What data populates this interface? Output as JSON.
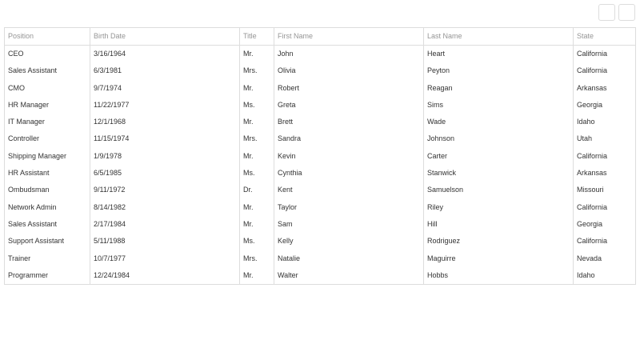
{
  "columns": [
    "Position",
    "Birth Date",
    "Title",
    "First Name",
    "Last Name",
    "State"
  ],
  "rows": [
    [
      "CEO",
      "3/16/1964",
      "Mr.",
      "John",
      "Heart",
      "California"
    ],
    [
      "Sales Assistant",
      "6/3/1981",
      "Mrs.",
      "Olivia",
      "Peyton",
      "California"
    ],
    [
      "CMO",
      "9/7/1974",
      "Mr.",
      "Robert",
      "Reagan",
      "Arkansas"
    ],
    [
      "HR Manager",
      "11/22/1977",
      "Ms.",
      "Greta",
      "Sims",
      "Georgia"
    ],
    [
      "IT Manager",
      "12/1/1968",
      "Mr.",
      "Brett",
      "Wade",
      "Idaho"
    ],
    [
      "Controller",
      "11/15/1974",
      "Mrs.",
      "Sandra",
      "Johnson",
      "Utah"
    ],
    [
      "Shipping Manager",
      "1/9/1978",
      "Mr.",
      "Kevin",
      "Carter",
      "California"
    ],
    [
      "HR Assistant",
      "6/5/1985",
      "Ms.",
      "Cynthia",
      "Stanwick",
      "Arkansas"
    ],
    [
      "Ombudsman",
      "9/11/1972",
      "Dr.",
      "Kent",
      "Samuelson",
      "Missouri"
    ],
    [
      "Network Admin",
      "8/14/1982",
      "Mr.",
      "Taylor",
      "Riley",
      "California"
    ],
    [
      "Sales Assistant",
      "2/17/1984",
      "Mr.",
      "Sam",
      "Hill",
      "Georgia"
    ],
    [
      "Support Assistant",
      "5/11/1988",
      "Ms.",
      "Kelly",
      "Rodriguez",
      "California"
    ],
    [
      "Trainer",
      "10/7/1977",
      "Mrs.",
      "Natalie",
      "Maguirre",
      "Nevada"
    ],
    [
      "Programmer",
      "12/24/1984",
      "Mr.",
      "Walter",
      "Hobbs",
      "Idaho"
    ]
  ],
  "colors": {
    "border": "#dddddd",
    "header_text": "#959595",
    "cell_text": "#333333"
  }
}
